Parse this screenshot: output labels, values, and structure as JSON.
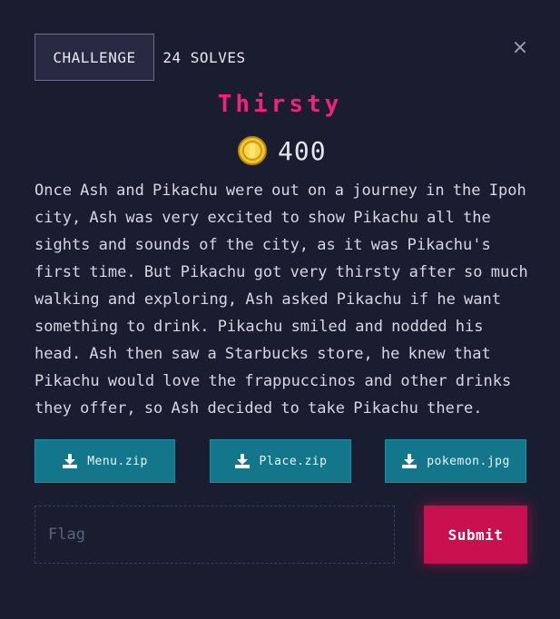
{
  "tabs": {
    "challenge_label": "CHALLENGE",
    "solves_label": "24 SOLVES"
  },
  "close_glyph": "×",
  "challenge": {
    "title": "Thirsty",
    "points": "400",
    "description": "Once Ash and Pikachu were out on a journey in the Ipoh city, Ash was very excited to show Pikachu all the sights and sounds of the city, as it was Pikachu's first time. But Pikachu got very thirsty after so much walking and exploring, Ash asked Pikachu if he want something to drink. Pikachu smiled and nodded his head. Ash then saw a Starbucks store, he knew that Pikachu would love the frappuccinos and other drinks they offer, so Ash decided to take Pikachu there."
  },
  "files": [
    {
      "label": "Menu.zip",
      "icon": "download-icon"
    },
    {
      "label": "Place.zip",
      "icon": "download-icon"
    },
    {
      "label": "pokemon.jpg",
      "icon": "download-icon"
    }
  ],
  "flag_input": {
    "placeholder": "Flag",
    "value": ""
  },
  "submit_label": "Submit",
  "colors": {
    "background": "#1a1d2f",
    "title": "#f0237a",
    "file_button": "#13768a",
    "submit": "#c8104e",
    "coin": "#f2c531"
  }
}
